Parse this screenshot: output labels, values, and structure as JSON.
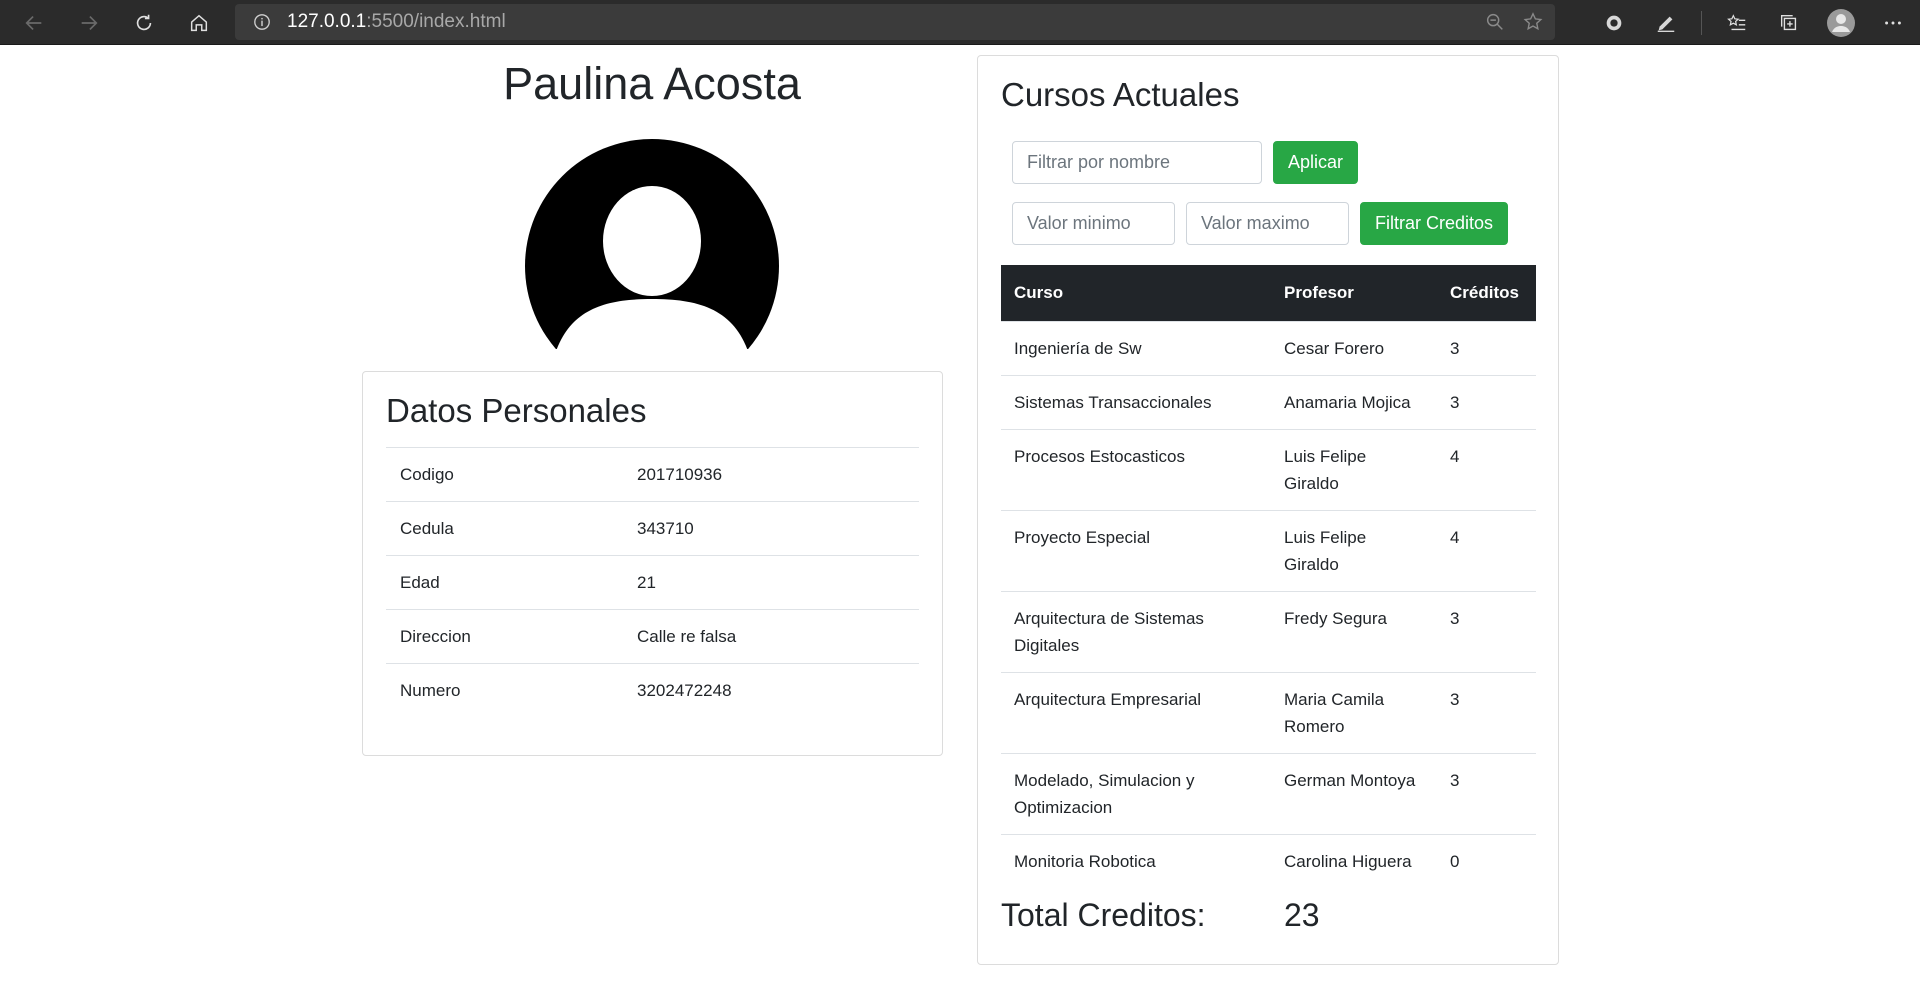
{
  "browser": {
    "url_host": "127.0.0.1",
    "url_path": ":5500/index.html"
  },
  "profile": {
    "name": "Paulina Acosta"
  },
  "personal": {
    "title": "Datos Personales",
    "rows": [
      {
        "label": "Codigo",
        "value": "201710936"
      },
      {
        "label": "Cedula",
        "value": "343710"
      },
      {
        "label": "Edad",
        "value": "21"
      },
      {
        "label": "Direccion",
        "value": "Calle re falsa"
      },
      {
        "label": "Numero",
        "value": "3202472248"
      }
    ]
  },
  "courses": {
    "title": "Cursos Actuales",
    "filter_name_placeholder": "Filtrar por nombre",
    "apply_label": "Aplicar",
    "min_placeholder": "Valor minimo",
    "max_placeholder": "Valor maximo",
    "filter_credits_label": "Filtrar Creditos",
    "headers": [
      "Curso",
      "Profesor",
      "Créditos"
    ],
    "rows": [
      {
        "curso": "Ingeniería de Sw",
        "profesor": "Cesar Forero",
        "creditos": "3"
      },
      {
        "curso": "Sistemas Transaccionales",
        "profesor": "Anamaria Mojica",
        "creditos": "3"
      },
      {
        "curso": "Procesos Estocasticos",
        "profesor": "Luis Felipe Giraldo",
        "creditos": "4"
      },
      {
        "curso": "Proyecto Especial",
        "profesor": "Luis Felipe Giraldo",
        "creditos": "4"
      },
      {
        "curso": "Arquitectura de Sistemas Digitales",
        "profesor": "Fredy Segura",
        "creditos": "3"
      },
      {
        "curso": "Arquitectura Empresarial",
        "profesor": "Maria Camila Romero",
        "creditos": "3"
      },
      {
        "curso": "Modelado, Simulacion y Optimizacion",
        "profesor": "German Montoya",
        "creditos": "3"
      },
      {
        "curso": "Monitoria Robotica",
        "profesor": "Carolina Higuera",
        "creditos": "0"
      }
    ],
    "total_label": "Total Creditos:",
    "total_value": "23"
  },
  "colors": {
    "chrome_bg": "#2b2b2b",
    "accent_green": "#28a745",
    "table_head_bg": "#212529"
  }
}
